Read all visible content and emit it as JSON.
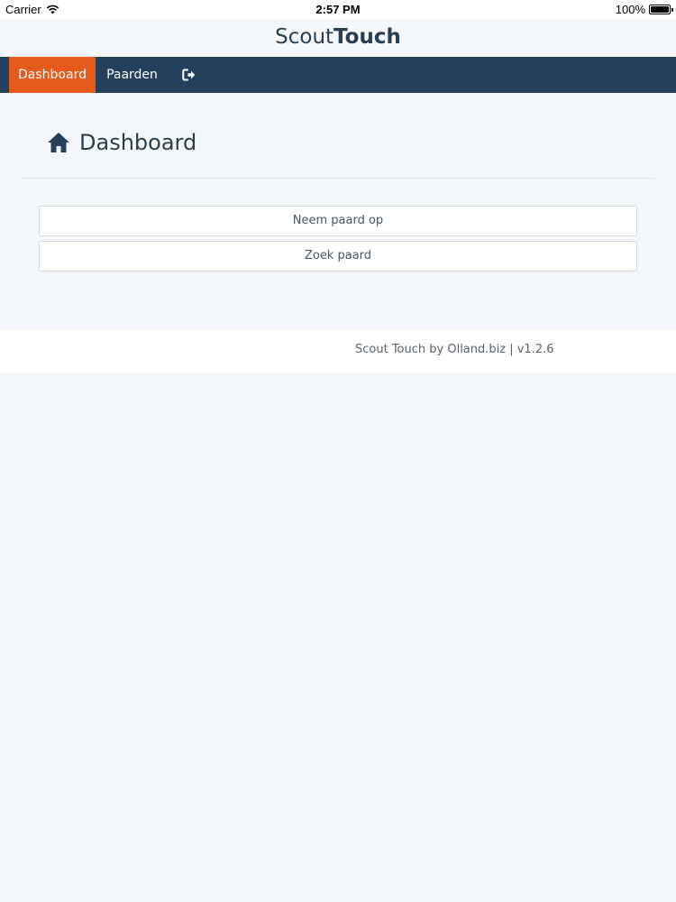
{
  "status_bar": {
    "carrier": "Carrier",
    "time": "2:57 PM",
    "battery": "100%",
    "battery_level": 1.0
  },
  "brand": {
    "part1": "Scout",
    "part2": "Touch"
  },
  "nav": {
    "items": [
      {
        "label": "Dashboard",
        "active": true
      },
      {
        "label": "Paarden",
        "active": false
      }
    ],
    "logout_icon": "sign-out-icon"
  },
  "page": {
    "icon": "home-icon",
    "title": "Dashboard"
  },
  "actions": [
    {
      "label": "Neem paard op"
    },
    {
      "label": "Zoek paard"
    }
  ],
  "footer": {
    "text": "Scout Touch by Olland.biz | v1.2.6"
  },
  "colors": {
    "nav_bg": "#24405c",
    "active_tab": "#e55a1d",
    "brand_text": "#2a3f56",
    "page_bg": "#f3f6fb"
  }
}
